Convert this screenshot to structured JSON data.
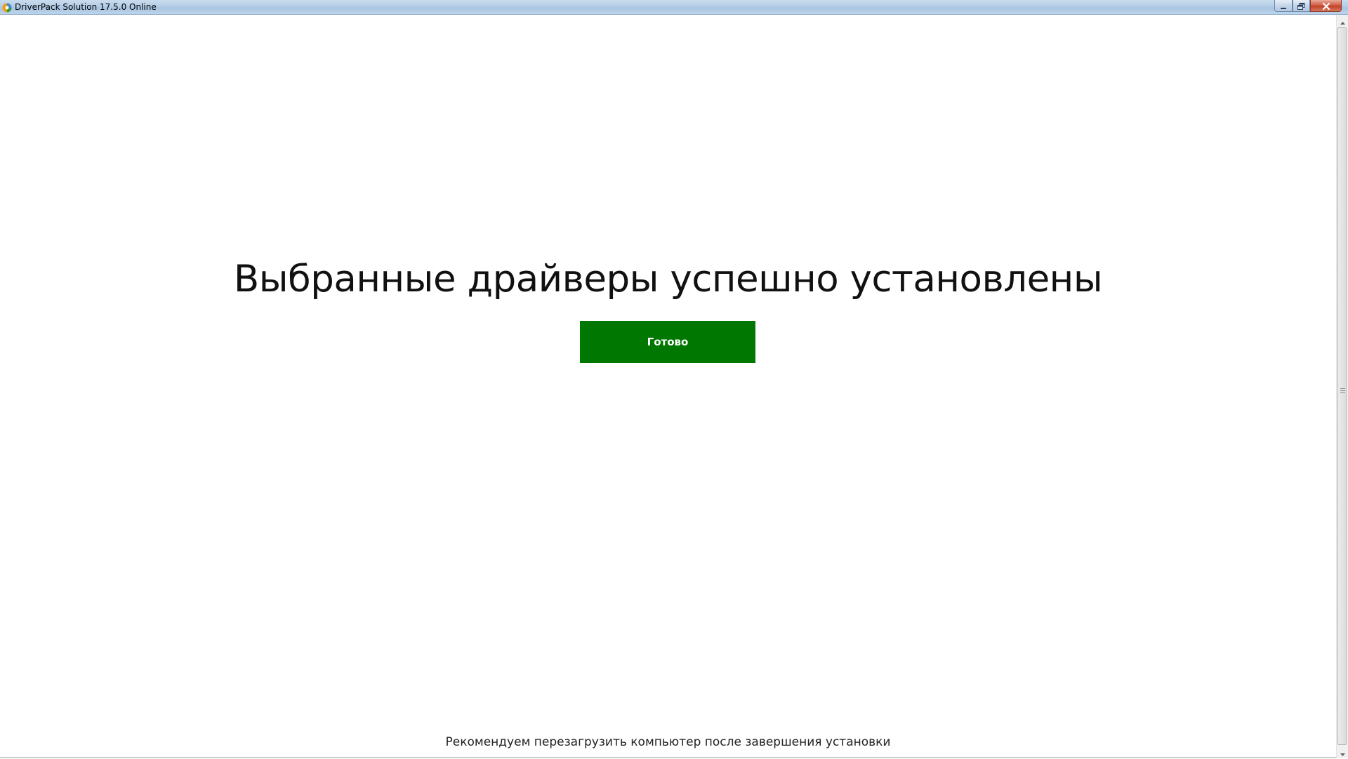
{
  "window": {
    "title": "DriverPack Solution 17.5.0 Online",
    "icon": "driverpack-logo-icon",
    "controls": {
      "minimize": "minimize-icon",
      "maximize": "maximize-icon",
      "close": "close-icon"
    }
  },
  "main": {
    "heading": "Выбранные драйверы успешно установлены",
    "done_button_label": "Готово",
    "footer_note": "Рекомендуем перезагрузить компьютер после завершения установки"
  },
  "colors": {
    "accent_green": "#007700",
    "background": "#ffffff",
    "text": "#111111"
  }
}
